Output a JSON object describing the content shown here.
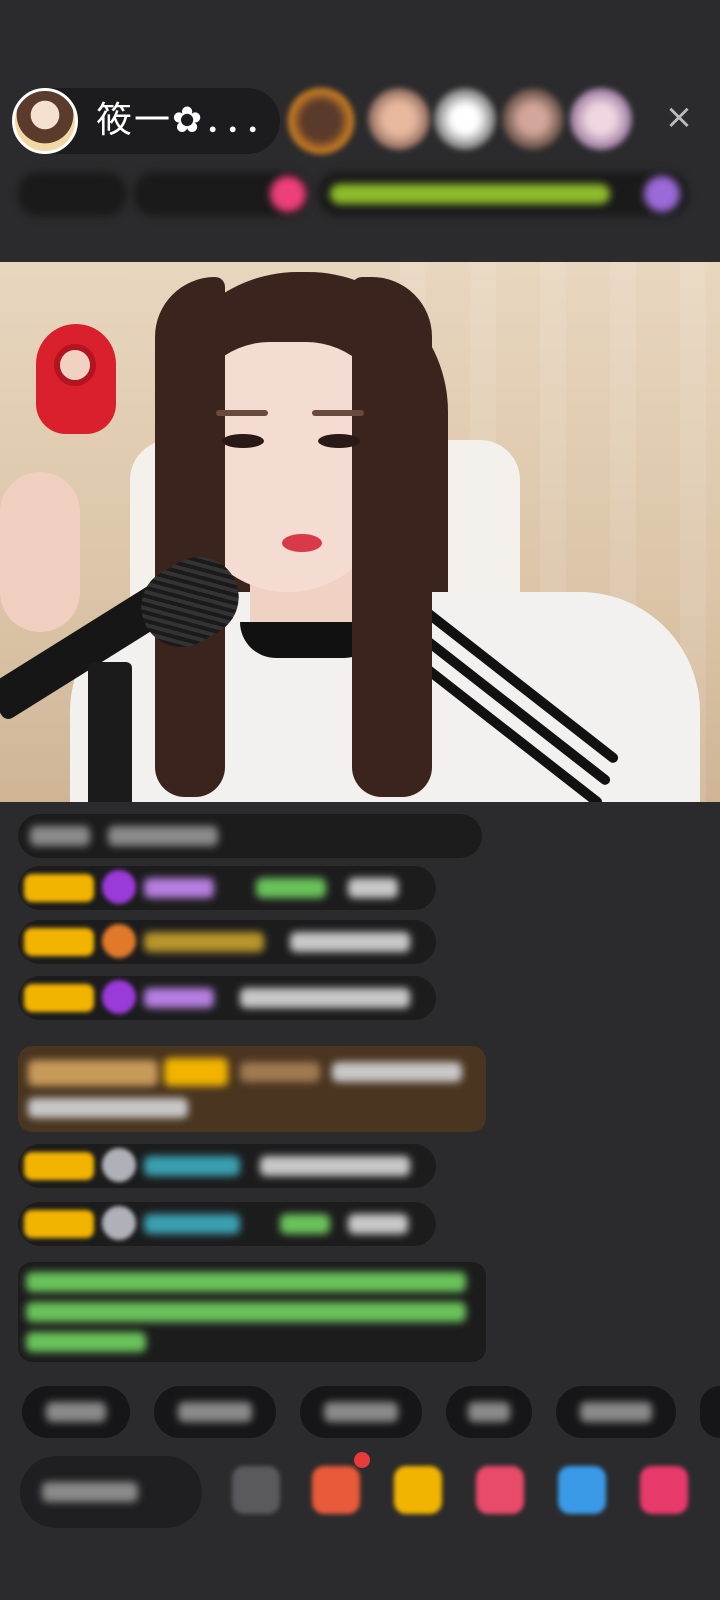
{
  "host": {
    "name": "筱一✿．．．"
  },
  "icons": {
    "close": "×"
  },
  "colors": {
    "background": "#2b2b2d",
    "level_badge": "#f2b400",
    "notice_bg": "#4a3520"
  }
}
